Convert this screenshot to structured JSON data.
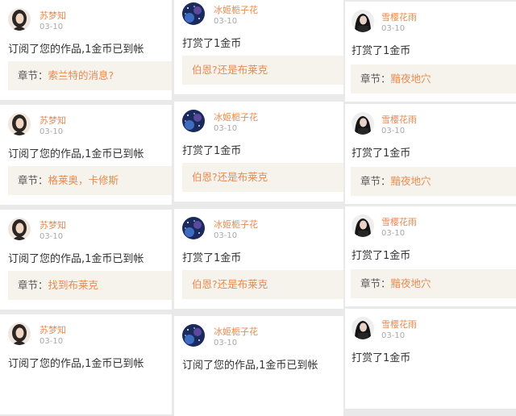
{
  "users": {
    "su": {
      "name": "苏梦知",
      "avatar_icon": "woman-portrait-avatar"
    },
    "bing": {
      "name": "冰姬栀子花",
      "avatar_icon": "starry-night-avatar"
    },
    "xue": {
      "name": "雪樱花雨",
      "avatar_icon": "dark-girl-avatar"
    }
  },
  "chapter_label": "章节：",
  "colors": {
    "name": "#e98a50",
    "date": "#a8a8a8",
    "chapter_bg": "#f5f3ec",
    "page_bg": "#e9e9e9"
  },
  "columns": [
    {
      "user": "su",
      "cards": [
        {
          "date": "03-10",
          "message": "订阅了您的作品,1金币已到帐",
          "chapter": "索兰特的消息?",
          "show_label": true
        },
        {
          "date": "03-10",
          "message": "订阅了您的作品,1金币已到帐",
          "chapter": "格莱奥，卡修斯",
          "show_label": true
        },
        {
          "date": "03-10",
          "message": "订阅了您的作品,1金币已到帐",
          "chapter": "找到布莱克",
          "show_label": true
        },
        {
          "date": "03-10",
          "message": "订阅了您的作品,1金币已到帐",
          "chapter": "",
          "show_label": false
        }
      ]
    },
    {
      "user": "bing",
      "cards": [
        {
          "date": "03-10",
          "message": "打赏了1金币",
          "chapter": "伯恩?还是布莱克",
          "show_label": false
        },
        {
          "date": "03-10",
          "message": "打赏了1金币",
          "chapter": "伯恩?还是布莱克",
          "show_label": false
        },
        {
          "date": "03-10",
          "message": "打赏了1金币",
          "chapter": "伯恩?还是布莱克",
          "show_label": false
        },
        {
          "date": "03-10",
          "message": "订阅了您的作品,1金币已到帐",
          "chapter": "",
          "show_label": false
        }
      ]
    },
    {
      "user": "xue",
      "cards": [
        {
          "date": "03-10",
          "message": "打赏了1金币",
          "chapter": "黯夜地穴",
          "show_label": true
        },
        {
          "date": "03-10",
          "message": "打赏了1金币",
          "chapter": "黯夜地穴",
          "show_label": true
        },
        {
          "date": "03-10",
          "message": "打赏了1金币",
          "chapter": "黯夜地穴",
          "show_label": true
        },
        {
          "date": "03-10",
          "message": "打赏了1金币",
          "chapter": "",
          "show_label": false
        }
      ]
    }
  ]
}
